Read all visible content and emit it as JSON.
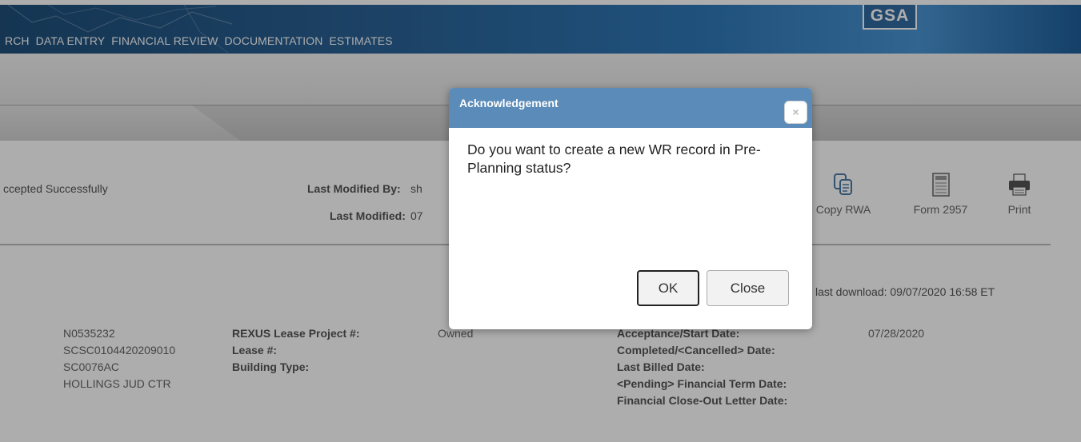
{
  "header": {
    "nav": [
      "RCH",
      "DATA ENTRY",
      "FINANCIAL REVIEW",
      "DOCUMENTATION",
      "ESTIMATES"
    ],
    "logo_text": "GSA"
  },
  "status": {
    "message": "ccepted Successfully",
    "last_modified_by_label": "Last Modified By:",
    "last_modified_by_value": "sh",
    "last_modified_label": "Last Modified:",
    "last_modified_value": "07"
  },
  "toolbar": {
    "copy_rwa": "Copy RWA",
    "form_2957": "Form 2957",
    "print": "Print"
  },
  "last_download": "last download: 09/07/2020 16:58 ET",
  "details": {
    "col1_values": [
      "N0535232",
      "SCSC0104420209010",
      "SC0076AC",
      "HOLLINGS JUD CTR"
    ],
    "col2_labels": [
      "REXUS Lease Project #:",
      "Lease #:",
      "Building Type:"
    ],
    "col2_values": [
      "",
      "",
      "Owned"
    ],
    "col3_labels": [
      "Acceptance/Start Date:",
      "Completed/<Cancelled> Date:",
      "Last Billed Date:",
      "<Pending> Financial Term Date:",
      "Financial Close-Out Letter Date:"
    ],
    "col3_values": [
      "07/28/2020"
    ]
  },
  "dialog": {
    "title": "Acknowledgement",
    "message": "Do you want to create a new WR record in Pre-Planning status?",
    "ok_label": "OK",
    "close_label": "Close",
    "close_icon": "×"
  },
  "colors": {
    "header_blue": "#2a6296",
    "dialog_title_bg": "#5b8bb8"
  }
}
